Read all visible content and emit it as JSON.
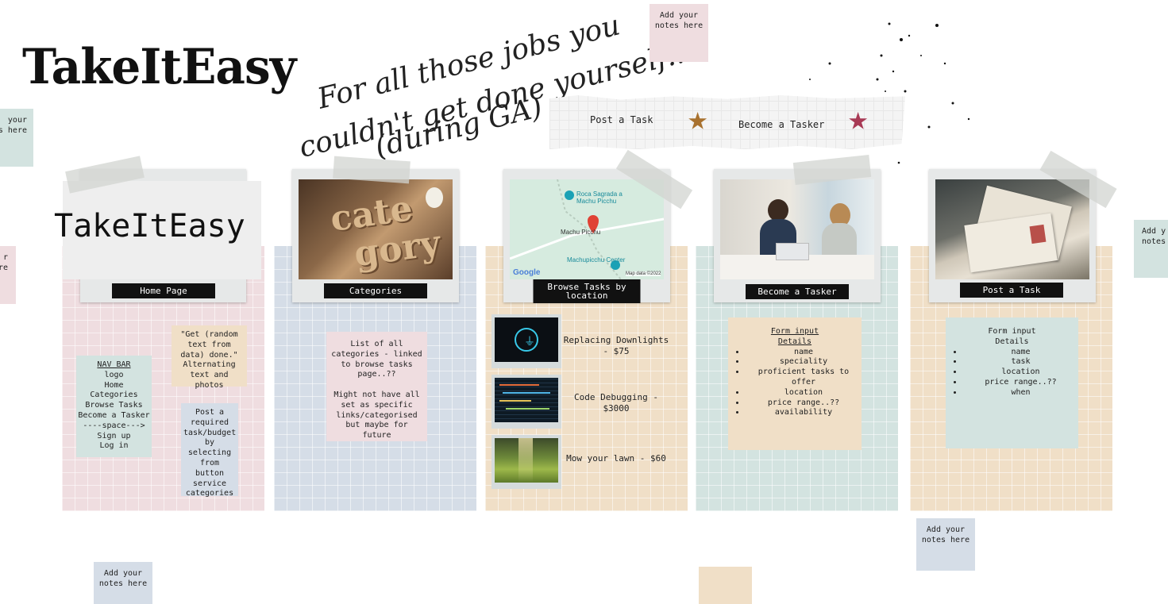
{
  "logo": "TakeItEasy",
  "tagline": [
    "For all those jobs you",
    "couldn't get done yourself...",
    "(during GA)"
  ],
  "header_links": {
    "post_task": "Post a Task",
    "become_tasker": "Become a Tasker"
  },
  "notes": {
    "top": "Add your notes here",
    "left_top": "your\ns here",
    "left_mid": "r\nre",
    "right_edge": "Add y\nnotes",
    "bottom_left": "Add your notes here",
    "bottom_right": "Add your notes here"
  },
  "pages": {
    "home": {
      "logo": "TakeItEasy",
      "caption": "Home Page",
      "nav_title": "NAV BAR",
      "nav_items": [
        "logo",
        "Home",
        "Categories",
        "Browse Tasks",
        "Become a Tasker",
        "----space--->",
        "Sign up",
        "Log in"
      ],
      "random_text": "\"Get (random text from data) done.\" Alternating text and photos",
      "post_note": "Post a required task/budget by selecting from button service categories"
    },
    "categories": {
      "caption": "Categories",
      "note": "List of all categories - linked to browse tasks page..??\n\nMight not have all set as specific links/categorised but maybe for future"
    },
    "browse": {
      "caption": "Browse Tasks by location",
      "map_labels": {
        "top": "Roca Sagrada a Machu Picchu",
        "mid": "Machu Picchu",
        "bottom": "Machupicchu Center",
        "google": "Google",
        "attribution": "Map data ©2022"
      },
      "tasks": [
        {
          "label": "Replacing Downlights - $75",
          "icon": "plug-icon"
        },
        {
          "label": "Code Debugging - $3000",
          "icon": "code-icon"
        },
        {
          "label": "Mow your lawn - $60",
          "icon": "lawn-icon"
        }
      ]
    },
    "tasker": {
      "caption": "Become a Tasker",
      "title": "Form input",
      "subtitle": "Details",
      "items": [
        "name",
        "speciality",
        "proficient tasks to offer",
        "location",
        "price range..??",
        "availability"
      ]
    },
    "post": {
      "caption": "Post a Task",
      "title": "Form input",
      "subtitle": "Details",
      "items": [
        "name",
        "task",
        "location",
        "price range..??",
        "when"
      ]
    }
  },
  "colors": {
    "pink": "#efdde0",
    "blue": "#d5dde7",
    "tan": "#f0dfc7",
    "teal": "#d3e3e0",
    "star_brown": "#a8712e",
    "star_red": "#a83a55"
  }
}
